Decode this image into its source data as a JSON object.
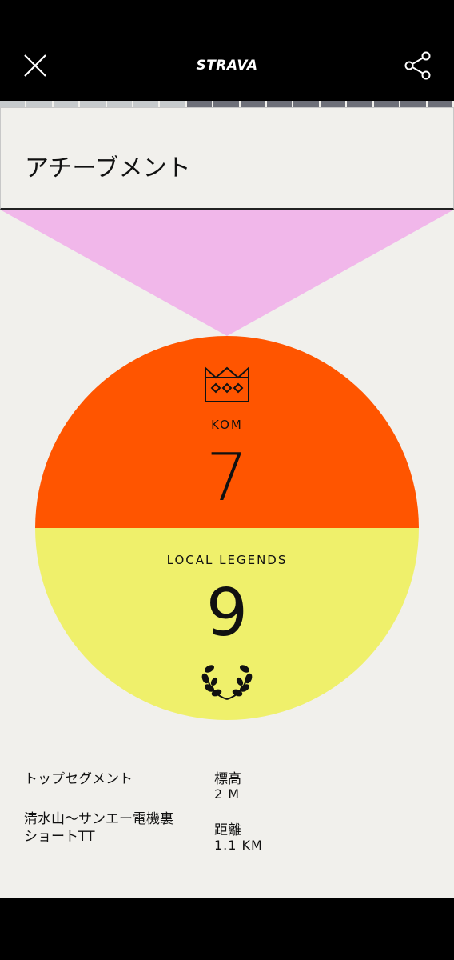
{
  "app": {
    "logo_text": "STRAVA"
  },
  "progress": {
    "completed_segments": 7,
    "total_segments": 17
  },
  "header": {
    "title": "アチーブメント"
  },
  "colors": {
    "kom": "#ff5500",
    "local_legends": "#eff06b",
    "ribbon": "#f1b7ea",
    "background": "#f1f0ec"
  },
  "achievements": {
    "kom": {
      "label": "KOM",
      "value": "7",
      "icon": "crown-icon"
    },
    "local_legends": {
      "label": "LOCAL LEGENDS",
      "value": "9",
      "icon": "laurel-icon"
    }
  },
  "stats": {
    "top_segment_label": "トップセグメント",
    "top_segment_name": "清水山〜サンエー電機裏ショートTT",
    "elevation_label": "標高",
    "elevation_value": "2 M",
    "distance_label": "距離",
    "distance_value": "1.1 KM"
  },
  "icons": {
    "close": "close-icon",
    "share": "share-icon"
  }
}
